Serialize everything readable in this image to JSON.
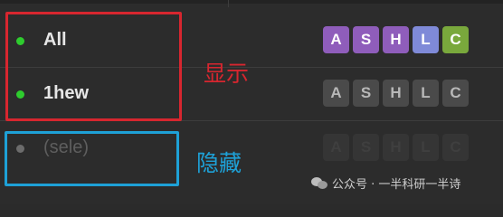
{
  "layers": [
    {
      "name": "All",
      "indicator": "active",
      "flag_style": "on",
      "flags": [
        {
          "label": "A",
          "color": "#8f5dbb"
        },
        {
          "label": "S",
          "color": "#8f5dbb"
        },
        {
          "label": "H",
          "color": "#8f5dbb"
        },
        {
          "label": "L",
          "color": "#7f8ad8"
        },
        {
          "label": "C",
          "color": "#79a83c"
        }
      ]
    },
    {
      "name": "1hew",
      "indicator": "active",
      "flag_style": "off",
      "flags": [
        {
          "label": "A"
        },
        {
          "label": "S"
        },
        {
          "label": "H"
        },
        {
          "label": "L"
        },
        {
          "label": "C"
        }
      ]
    },
    {
      "name": "(sele)",
      "indicator": "inactive",
      "flag_style": "faint",
      "flags": [
        {
          "label": "A"
        },
        {
          "label": "S"
        },
        {
          "label": "H"
        },
        {
          "label": "L"
        },
        {
          "label": "C"
        }
      ]
    }
  ],
  "annotations": {
    "shown_label": "显示",
    "hidden_label": "隐藏",
    "shown_color": "#d7262f",
    "hidden_color": "#1ea1d7"
  },
  "watermark": {
    "text": "公众号 · 一半科研一半诗",
    "icon": "wechat-icon"
  }
}
